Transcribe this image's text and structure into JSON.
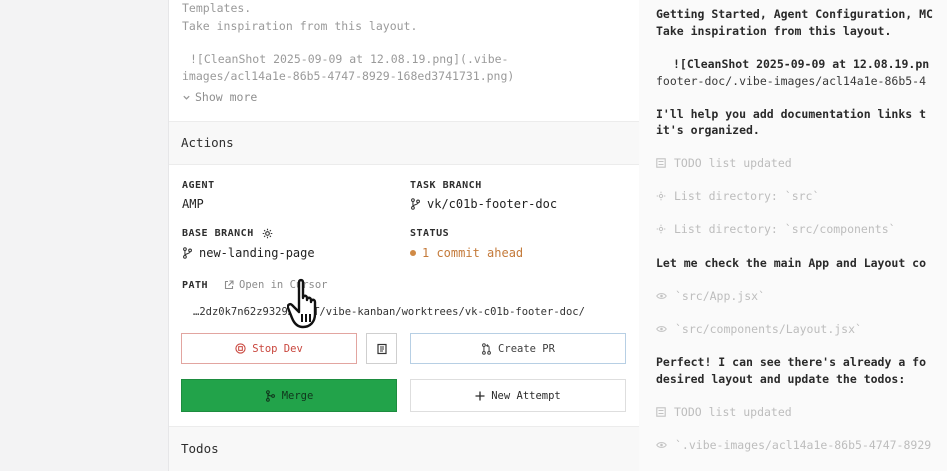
{
  "task_panel": {
    "description_lines": [
      "Templates.",
      "Take inspiration from this layout.",
      "![CleanShot 2025-09-09 at 12.08.19.png](.vibe-",
      "images/acl14a1e-86b5-4747-8929-168ed3741731.png)"
    ],
    "show_more_label": "Show more",
    "actions_title": "Actions",
    "agent_label": "AGENT",
    "agent_value": "AMP",
    "task_branch_label": "TASK BRANCH",
    "task_branch_value": "vk/c01b-footer-doc",
    "base_branch_label": "BASE BRANCH",
    "base_branch_value": "new-landing-page",
    "status_label": "STATUS",
    "status_value": "1 commit ahead",
    "path_label": "PATH",
    "open_in_editor_label": "Open in Cursor",
    "path_value": "…2dz0k7n62z9329…gn/T/vibe-kanban/worktrees/vk-c01b-footer-doc/",
    "stop_dev_label": "Stop Dev",
    "create_pr_label": "Create PR",
    "merge_label": "Merge",
    "new_attempt_label": "New Attempt",
    "todos_title": "Todos"
  },
  "conversation": {
    "line1": "Getting Started, Agent Configuration, MC",
    "line2": "Take inspiration from this layout.",
    "line3": "![CleanShot 2025-09-09 at 12.08.19.pn",
    "line4": "footer-doc/.vibe-images/acl14a1e-86b5-4",
    "line5": "I'll help you add documentation links t",
    "line6": "it's organized.",
    "todo1": "TODO list updated",
    "tool1": "List directory: `src`",
    "tool2": "List directory: `src/components`",
    "line7": "Let me check the main App and Layout co",
    "file1": "`src/App.jsx`",
    "file2": "`src/components/Layout.jsx`",
    "line8": "Perfect! I can see there's already a fo",
    "line9": "desired layout and update the todos:",
    "todo2": "TODO list updated",
    "file3": "`.vibe-images/acl14a1e-86b5-4747-8929"
  },
  "colors": {
    "merge": "#22a34a",
    "stop": "#c9463d",
    "status": "#c47a3a"
  }
}
